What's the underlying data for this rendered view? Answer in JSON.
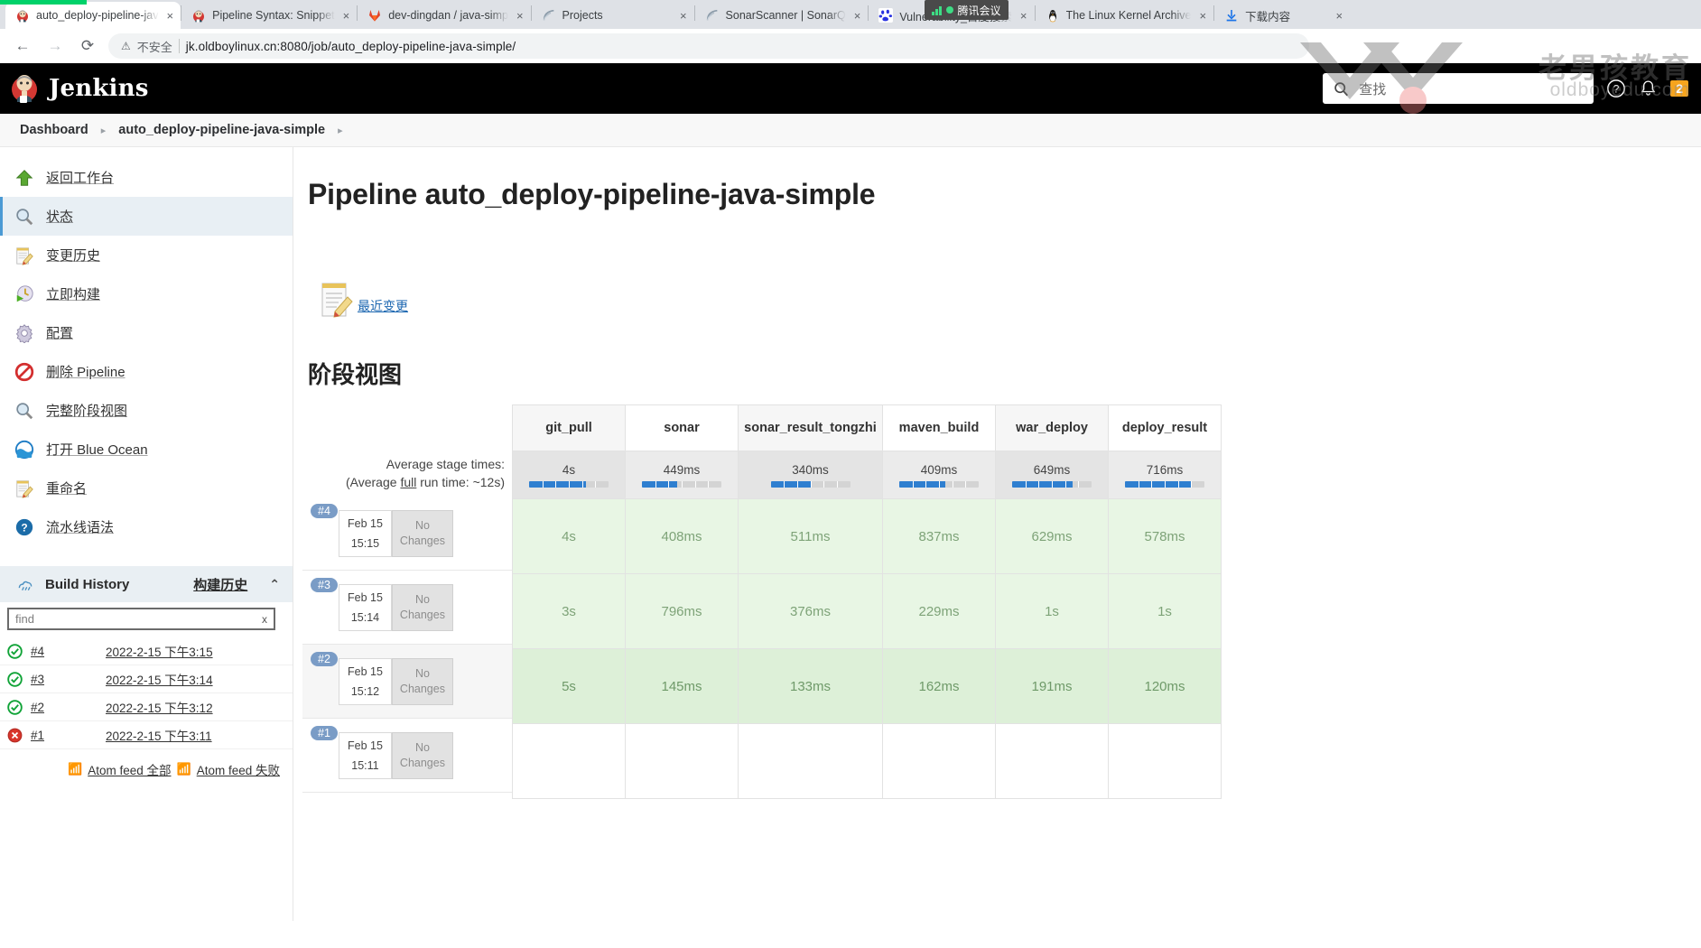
{
  "browser": {
    "tabs": [
      {
        "label": "auto_deploy-pipeline-jav",
        "icon": "jenkins-icon",
        "active": true
      },
      {
        "label": "Pipeline Syntax: Snippet",
        "icon": "jenkins-icon",
        "active": false
      },
      {
        "label": "dev-dingdan / java-simp",
        "icon": "gitlab-icon",
        "active": false
      },
      {
        "label": "Projects",
        "icon": "sonarqube-icon",
        "active": false
      },
      {
        "label": "SonarScanner | SonarQ",
        "icon": "sonarqube-icon",
        "active": false
      },
      {
        "label": "Vulnerability_百度搜索",
        "icon": "baidu-icon",
        "active": false
      },
      {
        "label": "The Linux Kernel Archive",
        "icon": "linux-icon",
        "active": false
      },
      {
        "label": "下载内容",
        "icon": "download-icon",
        "active": false
      }
    ],
    "close_label": "×",
    "back_icon": "←",
    "forward_icon": "→",
    "reload_icon": "⟳",
    "security_warning": "不安全",
    "security_icon": "⚠",
    "url": "jk.oldboylinux.cn:8080/job/auto_deploy-pipeline-java-simple/",
    "meeting_chip": "腾讯会议"
  },
  "jenkins_header": {
    "brand": "Jenkins",
    "search_placeholder": "查找",
    "search_value": "",
    "help_icon": "?",
    "bell_icon": "🔔",
    "notification_count": "2"
  },
  "watermark": {
    "cn": "老男孩教育",
    "en": "oldboyedu.com"
  },
  "breadcrumb": {
    "items": [
      "Dashboard",
      "auto_deploy-pipeline-java-simple"
    ],
    "separator": "▸"
  },
  "sidebar": {
    "items": [
      {
        "label": "返回工作台",
        "icon": "up-arrow-icon",
        "active": false
      },
      {
        "label": "状态",
        "icon": "magnifier-icon",
        "active": true
      },
      {
        "label": "变更历史",
        "icon": "notepad-pencil-icon",
        "active": false
      },
      {
        "label": "立即构建",
        "icon": "build-clock-icon",
        "active": false
      },
      {
        "label": "配置",
        "icon": "gear-icon",
        "active": false
      },
      {
        "label": "删除 Pipeline",
        "icon": "delete-forbidden-icon",
        "active": false
      },
      {
        "label": "完整阶段视图",
        "icon": "magnifier-icon",
        "active": false
      },
      {
        "label": "打开 Blue Ocean",
        "icon": "blue-ocean-icon",
        "active": false
      },
      {
        "label": "重命名",
        "icon": "notepad-pencil-icon",
        "active": false
      },
      {
        "label": "流水线语法",
        "icon": "help-circle-icon",
        "active": false
      }
    ],
    "build_history": {
      "title": "Build History",
      "zh_link": "构建历史",
      "collapse_icon": "⌃",
      "trend_icon": "build-trend-icon",
      "find_placeholder": "find",
      "find_value": "",
      "clear_label": "x",
      "rows": [
        {
          "number": "#4",
          "timestamp": "2022-2-15 下午3:15",
          "status": "success"
        },
        {
          "number": "#3",
          "timestamp": "2022-2-15 下午3:14",
          "status": "success"
        },
        {
          "number": "#2",
          "timestamp": "2022-2-15 下午3:12",
          "status": "success"
        },
        {
          "number": "#1",
          "timestamp": "2022-2-15 下午3:11",
          "status": "failed"
        }
      ],
      "atom_all": "Atom feed 全部",
      "atom_failed": "Atom feed 失败"
    }
  },
  "main": {
    "page_title": "Pipeline auto_deploy-pipeline-java-simple",
    "recent_changes_link": "最近变更",
    "recent_changes_icon": "notepad-pencil-icon",
    "stage_view_title": "阶段视图",
    "average_label": "Average stage times:",
    "average_sub_prefix": "(Average ",
    "average_sub_underline": "full",
    "average_sub_suffix": " run time: ~12s)"
  },
  "chart_data": {
    "type": "table",
    "title": "阶段视图",
    "stages": [
      "git_pull",
      "sonar",
      "sonar_result_tongzhi",
      "maven_build",
      "war_deploy",
      "deploy_result"
    ],
    "average_stage_times": [
      "4s",
      "449ms",
      "340ms",
      "409ms",
      "649ms",
      "716ms"
    ],
    "average_meter_fill_pct": [
      72,
      44,
      52,
      58,
      76,
      84
    ],
    "average_full_run_time": "~12s",
    "runs": [
      {
        "build": "#4",
        "date": "Feb 15",
        "time": "15:15",
        "changes": "No Changes",
        "status": "success",
        "shade": "light",
        "values": [
          "4s",
          "408ms",
          "511ms",
          "837ms",
          "629ms",
          "578ms"
        ]
      },
      {
        "build": "#3",
        "date": "Feb 15",
        "time": "15:14",
        "changes": "No Changes",
        "status": "success",
        "shade": "light",
        "values": [
          "3s",
          "796ms",
          "376ms",
          "229ms",
          "1s",
          "1s"
        ]
      },
      {
        "build": "#2",
        "date": "Feb 15",
        "time": "15:12",
        "changes": "No Changes",
        "status": "success",
        "shade": "dark",
        "values": [
          "5s",
          "145ms",
          "133ms",
          "162ms",
          "191ms",
          "120ms"
        ]
      },
      {
        "build": "#1",
        "date": "Feb 15",
        "time": "15:11",
        "changes": "No Changes",
        "status": "failed",
        "shade": "empty",
        "values": [
          "",
          "",
          "",
          "",
          "",
          ""
        ]
      }
    ],
    "no_changes_label": "No Changes"
  },
  "colors": {
    "accent": "#2f7fd0",
    "success_cell": "#e8f6e4",
    "success_cell_dark": "#ddf0d8",
    "build_badge": "#7a9cc6",
    "notification_badge": "#f7a41d",
    "jenkins_header_bg": "#000000",
    "sidebar_active_bg": "#e8eff4"
  }
}
